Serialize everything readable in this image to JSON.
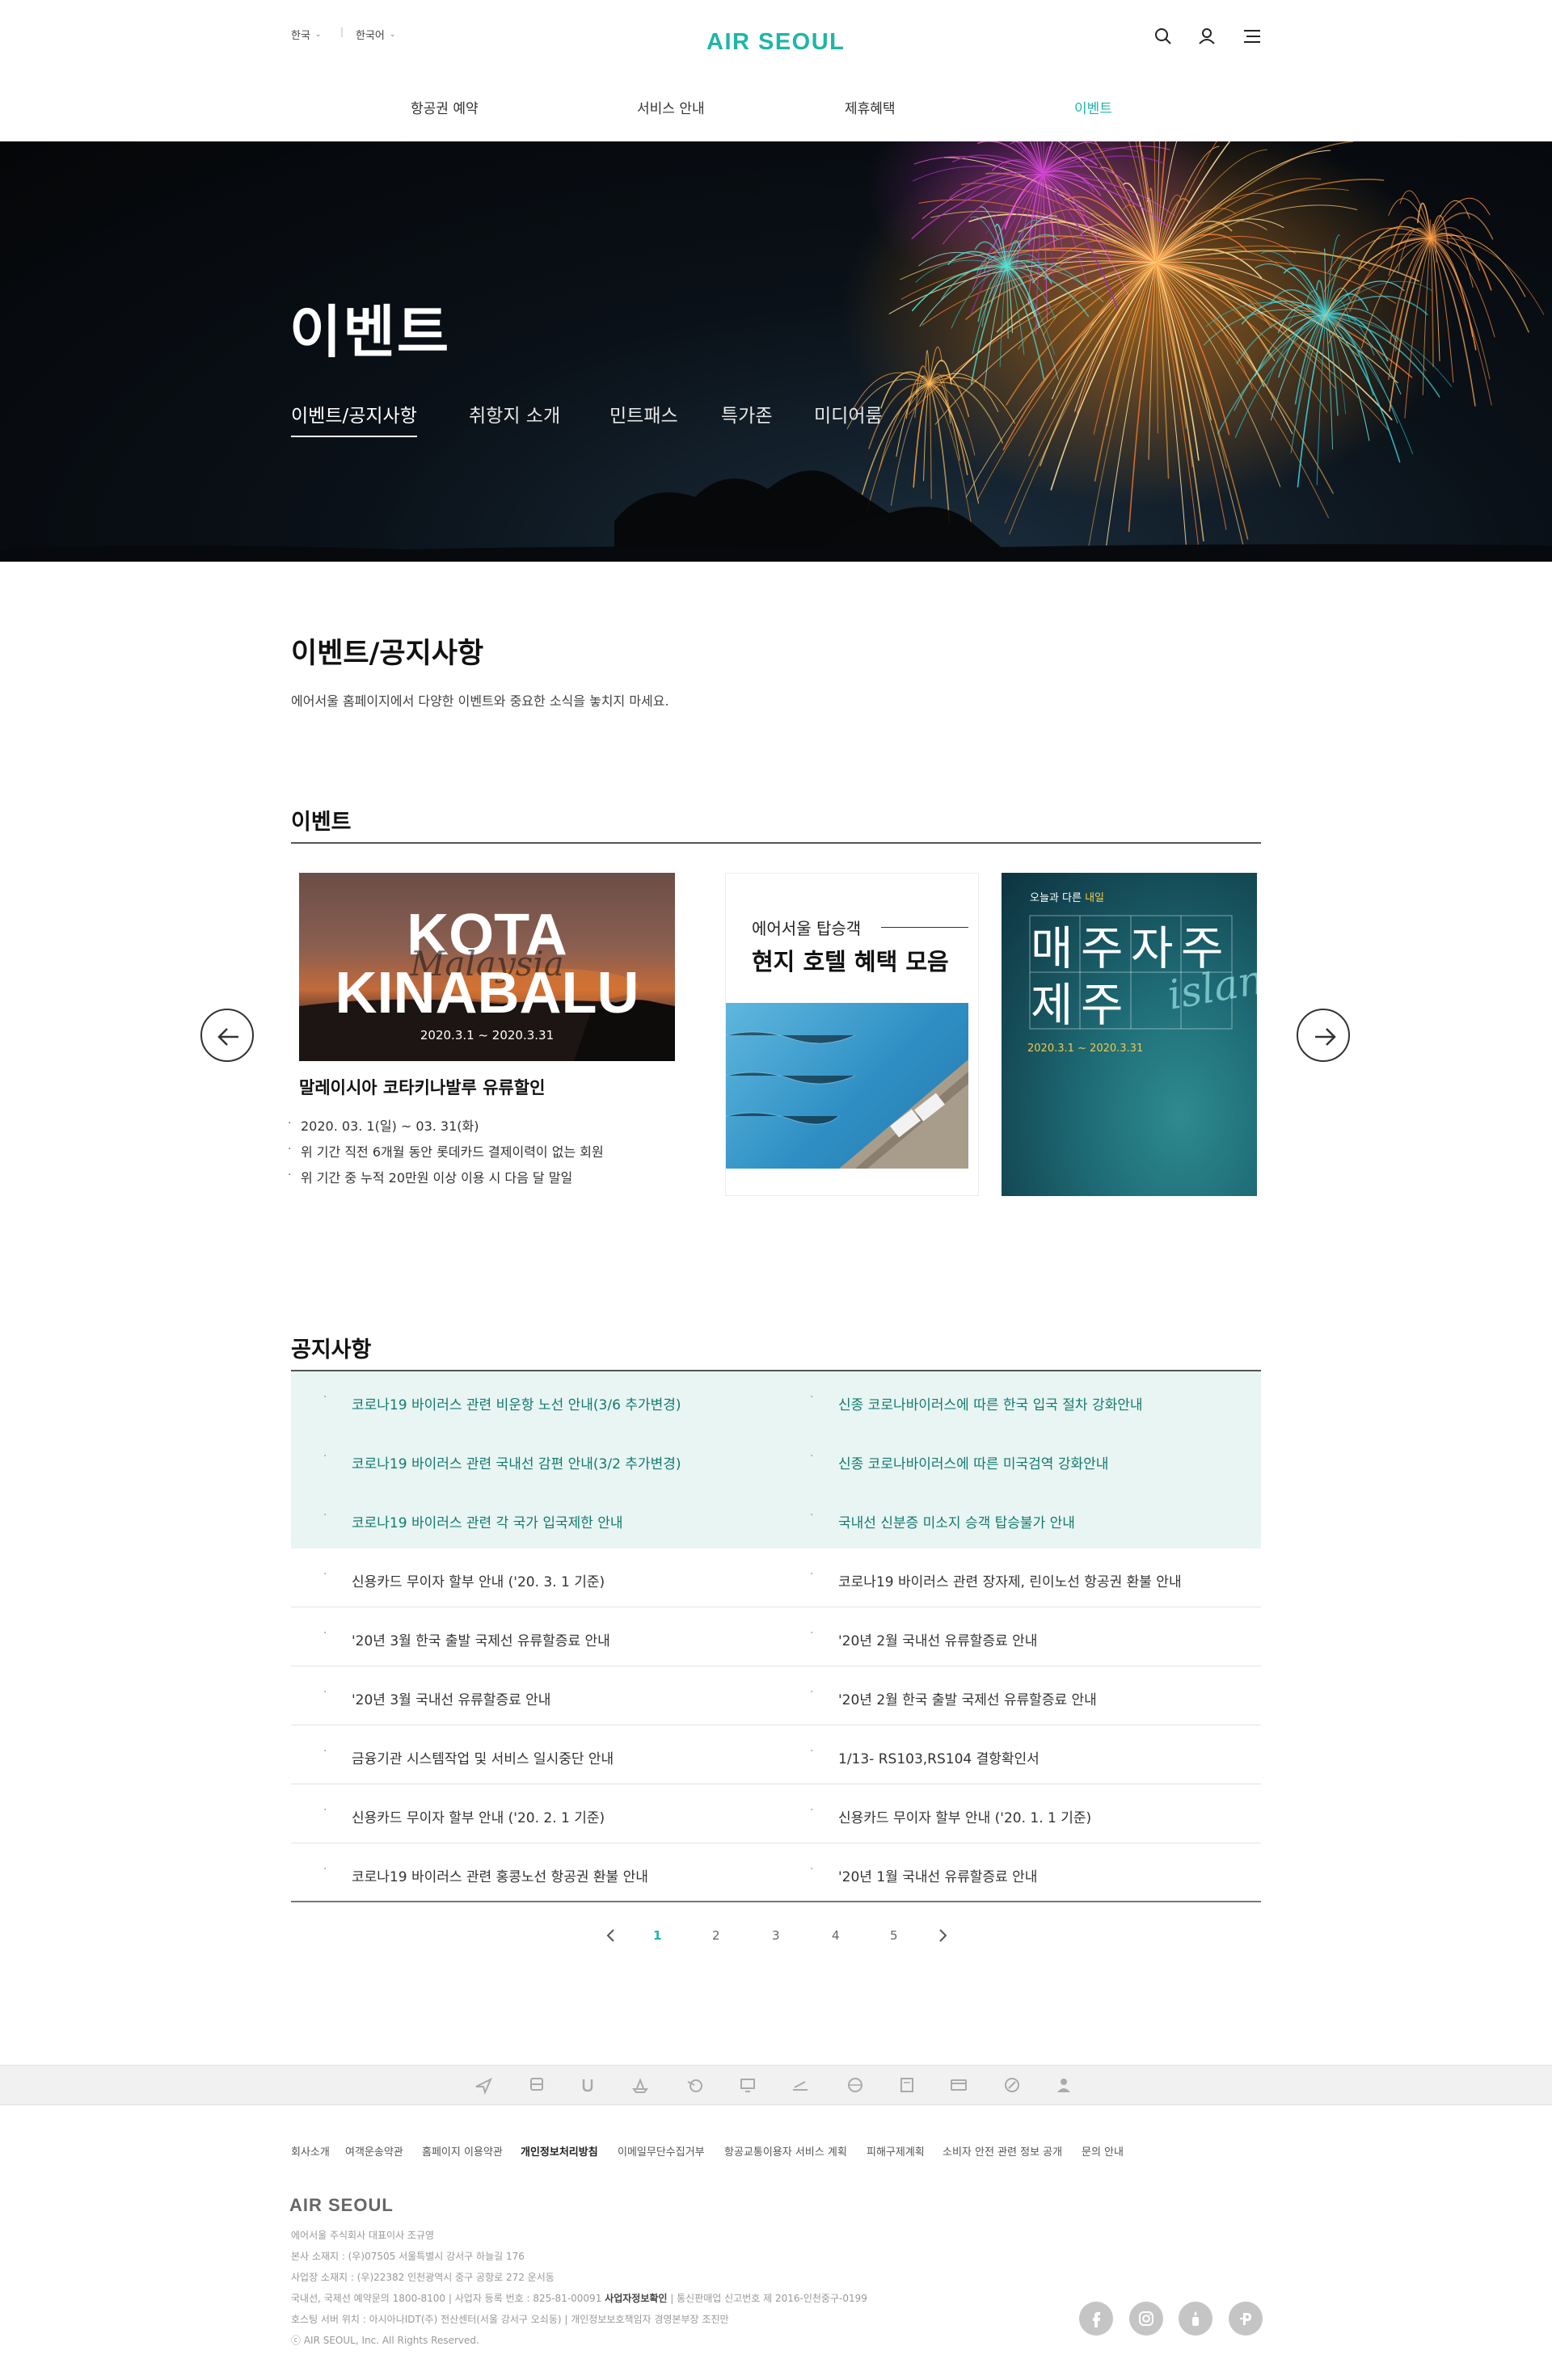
{
  "header": {
    "country": "한국",
    "language": "한국어",
    "logo_text": "AIR SEOUL",
    "nav": [
      {
        "label": "항공권 예약"
      },
      {
        "label": "서비스 안내"
      },
      {
        "label": "제휴혜택"
      },
      {
        "label": "이벤트",
        "active": true
      }
    ],
    "accent_color": "#1fb5a7"
  },
  "hero": {
    "title": "이벤트",
    "tabs": [
      {
        "label": "이벤트/공지사항",
        "active": true
      },
      {
        "label": "취항지 소개"
      },
      {
        "label": "민트패스"
      },
      {
        "label": "특가존"
      },
      {
        "label": "미디어룸"
      }
    ]
  },
  "page": {
    "heading": "이벤트/공지사항",
    "description": "에어서울 홈페이지에서 다양한 이벤트와 중요한 소식을 놓치지 마세요."
  },
  "events": {
    "section_title": "이벤트",
    "cards": [
      {
        "image_line1": "KOTA",
        "image_line2": "KINABALU",
        "image_script": "Malaysia",
        "image_dates": "2020.3.1 ~ 2020.3.31",
        "title": "말레이시아 코타키나발루 유류할인",
        "details": [
          "2020. 03. 1(일) ~ 03. 31(화)",
          "위 기간 직전 6개월 동안 롯데카드 결제이력이 없는 회원",
          "위 기간 중 누적 20만원 이상 이용 시 다음 달 말일"
        ]
      },
      {
        "image_small": "에어서울 탑승객",
        "image_large": "현지 호텔 혜택 모음"
      },
      {
        "image_top_prefix": "오늘과 다른 ",
        "image_top_highlight": "내일",
        "image_chars": [
          "매",
          "주",
          "자",
          "주",
          "제",
          "주"
        ],
        "image_script": "island",
        "image_dates": "2020.3.1 ~ 2020.3.31"
      }
    ]
  },
  "notices": {
    "section_title": "공지사항",
    "rows": [
      {
        "left": "코로나19 바이러스 관련 비운항 노선 안내(3/6 추가변경)",
        "right": "신종 코로나바이러스에 따른 한국 입국 절차 강화안내",
        "highlight": true
      },
      {
        "left": "코로나19 바이러스 관련 국내선 감편 안내(3/2 추가변경)",
        "right": "신종 코로나바이러스에 따른 미국검역 강화안내",
        "highlight": true
      },
      {
        "left": "코로나19 바이러스 관련 각 국가 입국제한 안내",
        "right": "국내선 신분증 미소지 승객 탑승불가 안내",
        "highlight": true
      },
      {
        "left": "신용카드 무이자 할부 안내 ('20. 3. 1 기준)",
        "right": "코로나19 바이러스 관련 장자제, 린이노선 항공권 환불 안내",
        "highlight": false
      },
      {
        "left": "'20년 3월 한국 출발 국제선 유류할증료 안내",
        "right": "'20년 2월 국내선 유류할증료 안내",
        "highlight": false
      },
      {
        "left": "'20년 3월 국내선 유류할증료 안내",
        "right": "'20년 2월 한국 출발 국제선 유류할증료 안내",
        "highlight": false
      },
      {
        "left": "금융기관 시스템작업 및 서비스 일시중단 안내",
        "right": "1/13- RS103,RS104 결항확인서",
        "highlight": false
      },
      {
        "left": "신용카드 무이자 할부 안내 ('20. 2. 1 기준)",
        "right": "신용카드 무이자 할부 안내 ('20. 1. 1 기준)",
        "highlight": false
      },
      {
        "left": "코로나19 바이러스 관련 홍콩노선 항공권 환불 안내",
        "right": "'20년 1월 국내선 유류할증료 안내",
        "highlight": false
      }
    ],
    "highlight_bg": "#e8f5f3",
    "highlight_text": "#137a6f",
    "pagination": {
      "pages": [
        "1",
        "2",
        "3",
        "4",
        "5"
      ],
      "current": "1"
    }
  },
  "footer": {
    "icons": [
      "plane-icon",
      "bus-icon",
      "umbrella-icon",
      "ship-icon",
      "globe-plane-icon",
      "monitor-icon",
      "departure-icon",
      "globe-icon",
      "calculator-icon",
      "card-icon",
      "percent-icon",
      "person-icon"
    ],
    "links": [
      {
        "label": "회사소개"
      },
      {
        "label": "여객운송약관"
      },
      {
        "label": "홈페이지 이용약관"
      },
      {
        "label": "개인정보처리방침",
        "bold": true
      },
      {
        "label": "이메일무단수집거부"
      },
      {
        "label": "항공교통이용자 서비스 계획"
      },
      {
        "label": "피해구제계획"
      },
      {
        "label": "소비자 안전 관련 정보 공개"
      },
      {
        "label": "문의 안내"
      }
    ],
    "logo_text": "AIR SEOUL",
    "company": "에어서울 주식회사 대표이사 조규영",
    "hq_address": "본사 소재지 : (우)07505 서울특별시 강서구 하늘길 176",
    "office_address": "사업장 소재지 : (우)22382 인천광역시 중구 공항로 272 운서동",
    "contact_prefix": "국내선, 국제선 예약문의 1800-8100  |  사업자 등록 번호 : 825-81-00091 ",
    "contact_bold": "사업자정보확인",
    "contact_suffix": "  |  통신판매업 신고번호 제 2016-인천중구-0199",
    "hosting": "호스팅 서버 위치 : 아시아나IDT(주) 전산센터(서울 강서구 오쇠동)  |  개인정보보호책임자 경영본부장 조진만",
    "copyright": "ⓒ AIR SEOUL, Inc. All Rights Reserved.",
    "social": [
      "facebook-icon",
      "instagram-icon",
      "blog-icon",
      "post-icon"
    ]
  }
}
